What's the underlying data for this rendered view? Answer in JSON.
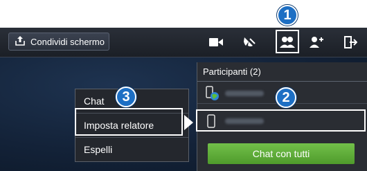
{
  "toolbar": {
    "share_label": "Condividi schermo",
    "icons": [
      "share-icon",
      "video-camera-icon",
      "end-call-icon",
      "participants-icon",
      "add-participant-icon",
      "exit-icon"
    ]
  },
  "callouts": {
    "c1": "1",
    "c2": "2",
    "c3": "3"
  },
  "participants_panel": {
    "title": "Participanti (2)",
    "chat_all_label": "Chat con tutti"
  },
  "context_menu": {
    "items": [
      {
        "label": "Chat"
      },
      {
        "label": "Imposta relatore"
      },
      {
        "label": "Espelli"
      }
    ]
  },
  "colors": {
    "accent_blue": "#1d6fc4",
    "chat_green": "#5aa934",
    "panel_bg": "#2a2d33"
  }
}
